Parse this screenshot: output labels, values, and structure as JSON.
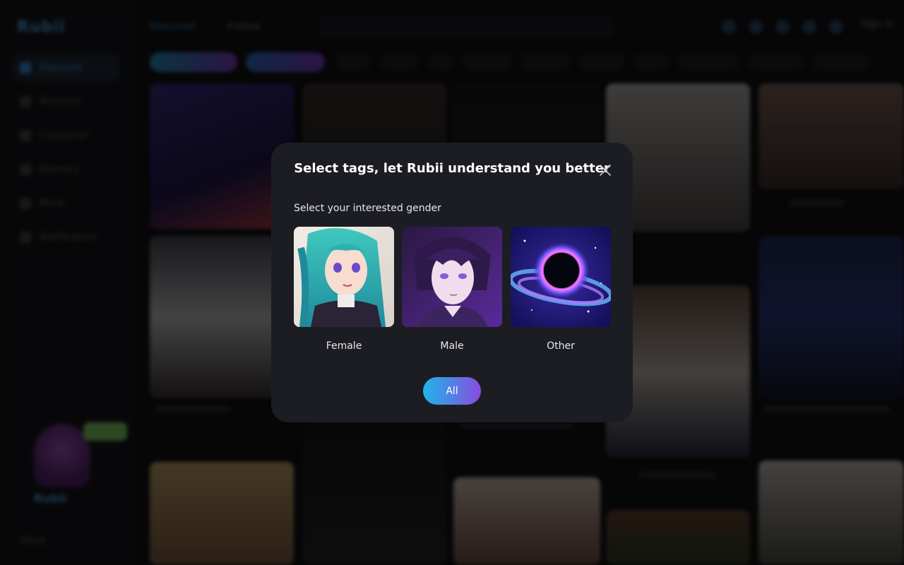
{
  "background": {
    "logo": "Rubii",
    "nav_items": [
      "Discover",
      "Moment",
      "Character",
      "Memory",
      "More",
      "Notification"
    ],
    "top_tabs": [
      "Discover",
      "Follow"
    ],
    "sign_in": "Sign In",
    "mascot_name": "Rubii",
    "more": "More"
  },
  "modal": {
    "title": "Select tags, let Rubii understand you better",
    "section_label": "Select your interested gender",
    "options": [
      {
        "label": "Female"
      },
      {
        "label": "Male"
      },
      {
        "label": "Other"
      }
    ],
    "all_button": "All"
  },
  "colors": {
    "modal_bg": "#1c1d22",
    "accent_start": "#1fb6e8",
    "accent_end": "#8a4ae0"
  }
}
